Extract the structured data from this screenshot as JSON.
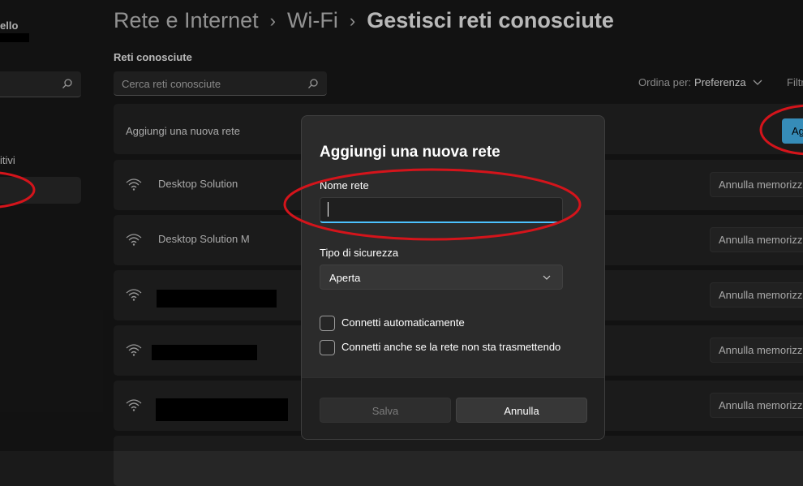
{
  "sidebar": {
    "user_name_fragment": "ello",
    "item_fragment": "itivi"
  },
  "header": {
    "breadcrumb": [
      "Rete e Internet",
      "Wi-Fi",
      "Gestisci reti conosciute"
    ],
    "separator": "›"
  },
  "known_networks": {
    "section_label": "Reti conosciute",
    "search_placeholder": "Cerca reti conosciute",
    "sort_label": "Ordina per:",
    "sort_value": "Preferenza",
    "filter_label": "Filtr",
    "add_row_label": "Aggiungi una nuova rete",
    "add_button_label": "Agg",
    "forget_label": "Annulla memorizz",
    "networks": [
      {
        "name": "Desktop Solution",
        "redacted": false
      },
      {
        "name": "Desktop Solution M",
        "redacted": false
      },
      {
        "name": "",
        "redacted": true
      },
      {
        "name": "",
        "redacted": true
      },
      {
        "name": "",
        "redacted": true
      }
    ]
  },
  "dialog": {
    "title": "Aggiungi una nuova rete",
    "network_name_label": "Nome rete",
    "network_name_value": "",
    "security_label": "Tipo di sicurezza",
    "security_value": "Aperta",
    "checkbox_auto": "Connetti automaticamente",
    "checkbox_hidden": "Connetti anche se la rete non sta trasmettendo",
    "checkbox_auto_checked": false,
    "checkbox_hidden_checked": false,
    "save_label": "Salva",
    "cancel_label": "Annulla"
  },
  "colors": {
    "accent": "#4cc2ff",
    "annotation": "#d4141b",
    "background": "#1a1a1a"
  }
}
